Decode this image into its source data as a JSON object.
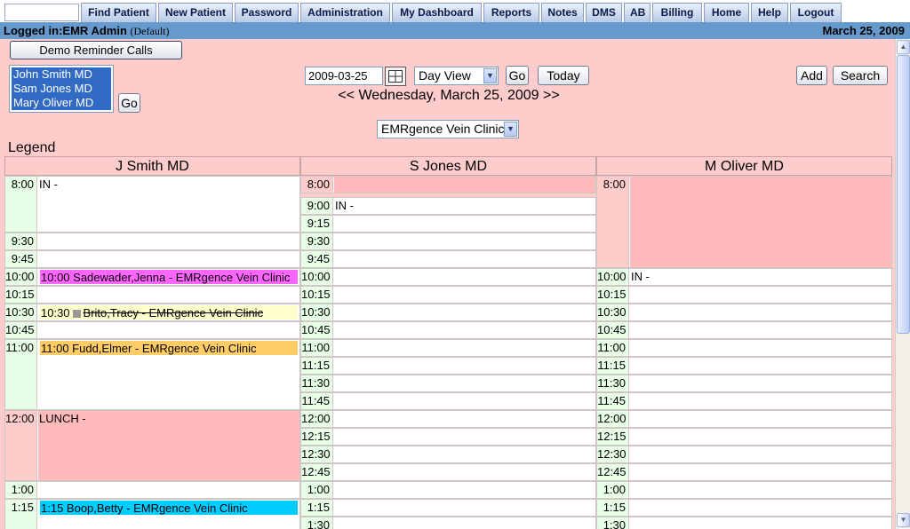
{
  "nav": {
    "tabs": [
      "Find Patient",
      "New Patient",
      "Password",
      "Administration",
      "My Dashboard",
      "Reports",
      "Notes",
      "DMS",
      "AB",
      "Billing",
      "Home",
      "Help",
      "Logout"
    ]
  },
  "status": {
    "login": "Logged in:EMR Admin",
    "role": "(Default)",
    "date": "March 25, 2009"
  },
  "toolbar": {
    "demo_button": "Demo Reminder Calls",
    "providers": [
      "John Smith MD",
      "Sam Jones MD",
      "Mary Oliver MD"
    ],
    "go_label": "Go",
    "date_value": "2009-03-25",
    "view_select": "Day View",
    "today_label": "Today",
    "add_label": "Add",
    "search_label": "Search",
    "date_nav": "<<  Wednesday, March 25, 2009 >>",
    "clinic_select": "EMRgence Vein Clinic",
    "legend": "Legend"
  },
  "columns": [
    "J Smith MD",
    "S Jones MD",
    "M Oliver MD"
  ],
  "schedule": {
    "smith": [
      {
        "time": "8:00",
        "text": "IN -"
      },
      {
        "time": "9:30",
        "text": ""
      },
      {
        "time": "9:45",
        "text": ""
      },
      {
        "time": "10:00",
        "text": "10:00 Sadewader,Jenna - EMRgence Vein Clinic"
      },
      {
        "time": "10:15",
        "text": ""
      },
      {
        "time": "10:30",
        "prefix": "10:30",
        "text": "Brito,Tracy - EMRgence Vein Clinic"
      },
      {
        "time": "10:45",
        "text": ""
      },
      {
        "time": "11:00",
        "text": "11:00 Fudd,Elmer - EMRgence Vein Clinic"
      },
      {
        "time": "12:00",
        "text": "LUNCH -"
      },
      {
        "time": "1:00",
        "text": ""
      },
      {
        "time": "1:15",
        "text": "1:15 Boop,Betty - EMRgence Vein Clinic"
      }
    ],
    "jones": [
      {
        "time": "8:00",
        "text": ""
      },
      {
        "time": "9:00",
        "text": "IN -"
      },
      {
        "time": "9:15",
        "text": ""
      },
      {
        "time": "9:30",
        "text": ""
      },
      {
        "time": "9:45",
        "text": ""
      },
      {
        "time": "10:00",
        "text": ""
      },
      {
        "time": "10:15",
        "text": ""
      },
      {
        "time": "10:30",
        "text": ""
      },
      {
        "time": "10:45",
        "text": ""
      },
      {
        "time": "11:00",
        "text": ""
      },
      {
        "time": "11:15",
        "text": ""
      },
      {
        "time": "11:30",
        "text": ""
      },
      {
        "time": "11:45",
        "text": ""
      },
      {
        "time": "12:00",
        "text": ""
      },
      {
        "time": "12:15",
        "text": ""
      },
      {
        "time": "12:30",
        "text": ""
      },
      {
        "time": "12:45",
        "text": ""
      },
      {
        "time": "1:00",
        "text": ""
      },
      {
        "time": "1:15",
        "text": ""
      },
      {
        "time": "1:30",
        "text": ""
      }
    ],
    "oliver": [
      {
        "time": "8:00",
        "text": ""
      },
      {
        "time": "10:00",
        "text": "IN -"
      },
      {
        "time": "10:15",
        "text": ""
      },
      {
        "time": "10:30",
        "text": ""
      },
      {
        "time": "10:45",
        "text": ""
      },
      {
        "time": "11:00",
        "text": ""
      },
      {
        "time": "11:15",
        "text": ""
      },
      {
        "time": "11:30",
        "text": ""
      },
      {
        "time": "11:45",
        "text": ""
      },
      {
        "time": "12:00",
        "text": ""
      },
      {
        "time": "12:15",
        "text": ""
      },
      {
        "time": "12:30",
        "text": ""
      },
      {
        "time": "12:45",
        "text": ""
      },
      {
        "time": "1:00",
        "text": ""
      },
      {
        "time": "1:15",
        "text": ""
      },
      {
        "time": "1:30",
        "text": ""
      }
    ]
  },
  "colors": {
    "status_bar": "#6699cc",
    "page_bg": "#ffcccc",
    "appt_sadewader": "#ff66ff",
    "appt_brito": "#ffffcc",
    "appt_fudd": "#ffcc66",
    "appt_boop": "#00ccff",
    "lunch": "#ffbbbb"
  }
}
